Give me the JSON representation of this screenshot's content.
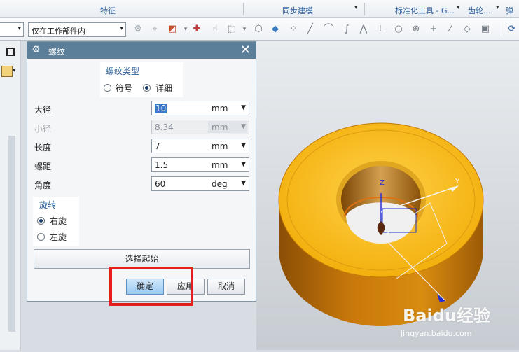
{
  "ribbon": {
    "groups": [
      "特征",
      "同步建模",
      "标准化工具 - G...",
      "齿轮...",
      "弹簧"
    ]
  },
  "toolbar": {
    "filter_value": "仅在工作部件内"
  },
  "dialog": {
    "title": "螺纹",
    "thread_type": {
      "header": "螺纹类型",
      "options": [
        "符号",
        "详细"
      ],
      "selected": "详细"
    },
    "fields": [
      {
        "label": "大径",
        "value": "10",
        "unit": "mm",
        "enabled": true,
        "selected_text": true
      },
      {
        "label": "小径",
        "value": "8.34",
        "unit": "mm",
        "enabled": false
      },
      {
        "label": "长度",
        "value": "7",
        "unit": "mm",
        "enabled": true
      },
      {
        "label": "螺距",
        "value": "1.5",
        "unit": "mm",
        "enabled": true
      },
      {
        "label": "角度",
        "value": "60",
        "unit": "deg",
        "enabled": true
      }
    ],
    "rotation": {
      "header": "旋转",
      "options": [
        "右旋",
        "左旋"
      ],
      "selected": "右旋"
    },
    "select_start_label": "选择起始",
    "buttons": {
      "ok": "确定",
      "apply": "应用",
      "cancel": "取消"
    }
  },
  "viewport": {
    "axis_labels": [
      "Z",
      "Y"
    ],
    "watermark": "Baidu经验",
    "watermark_url": "jingyan.baidu.com"
  },
  "colors": {
    "dialog_title_bg": "#5b7f98",
    "part_face": "#f5b40a",
    "part_side": "#c8780a",
    "highlight_frame": "#e61e1e"
  }
}
